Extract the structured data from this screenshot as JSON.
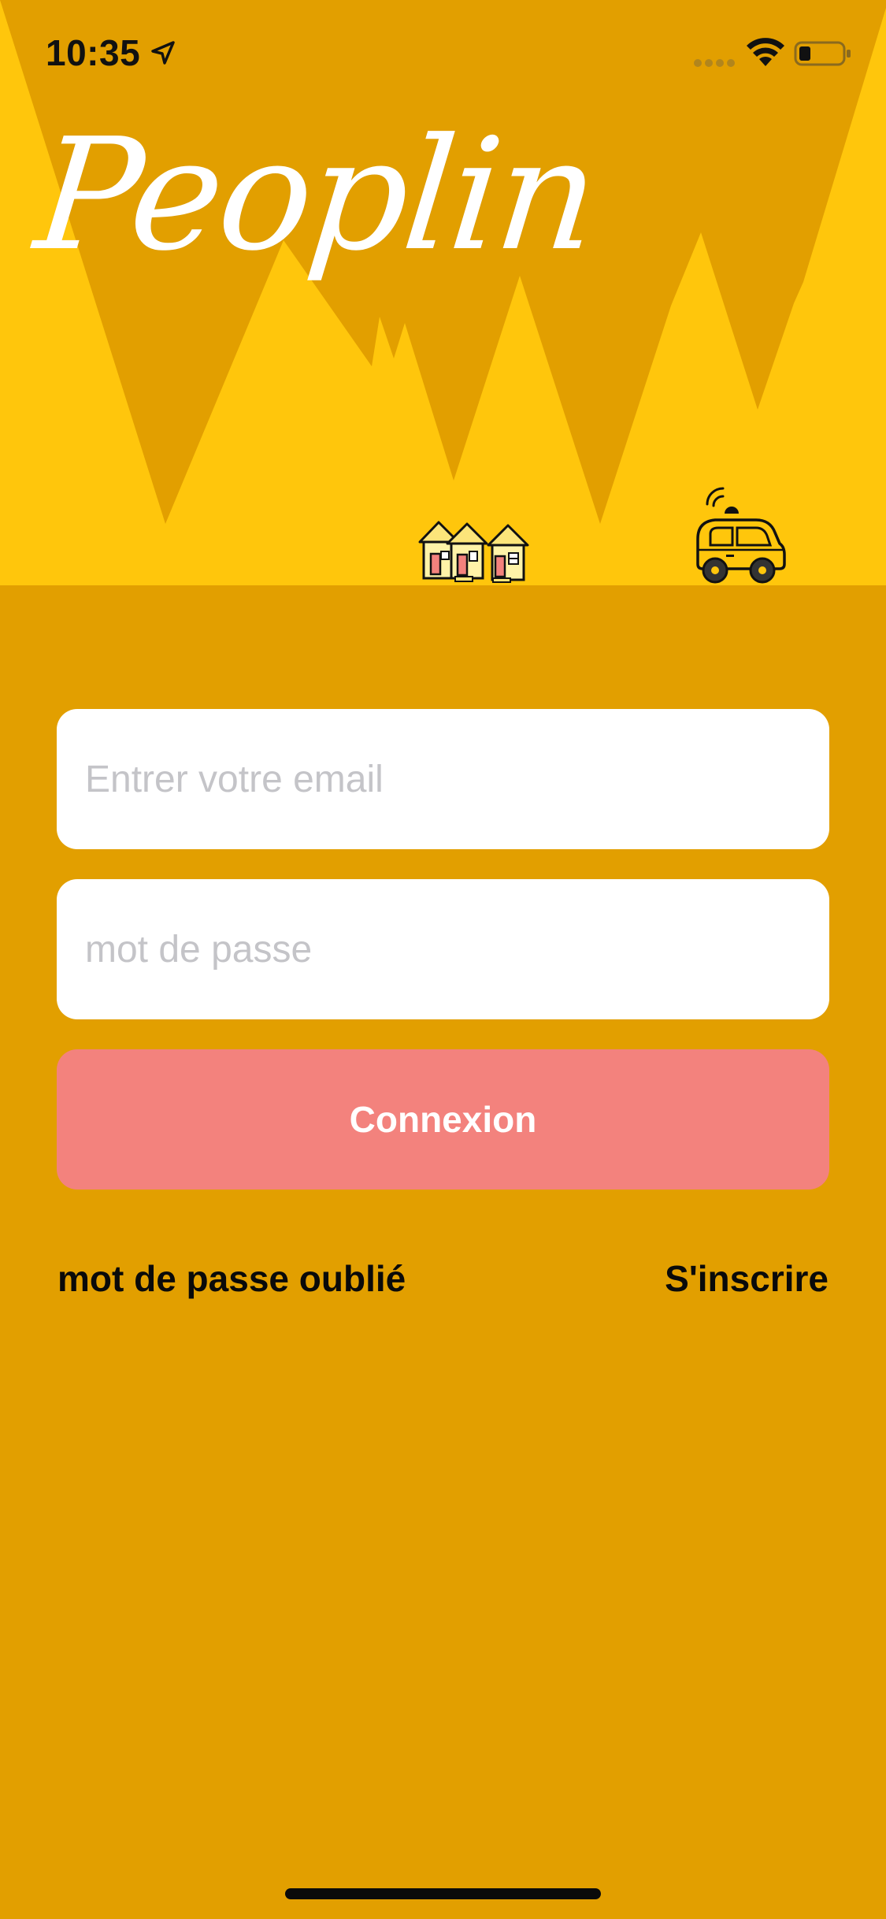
{
  "status_bar": {
    "time": "10:35",
    "location_icon": "location-arrow-icon",
    "signal_icon": "cellular-signal-icon",
    "wifi_icon": "wifi-icon",
    "battery_icon": "battery-low-icon"
  },
  "header": {
    "logo_text": "Peoplin",
    "illustration_icons": [
      "houses-icon",
      "connected-car-icon"
    ]
  },
  "form": {
    "email": {
      "value": "",
      "placeholder": "Entrer votre email"
    },
    "password": {
      "value": "",
      "placeholder": "mot de passe"
    },
    "submit_label": "Connexion"
  },
  "links": {
    "forgot_password": "mot de passe oublié",
    "signup": "S'inscrire"
  },
  "colors": {
    "background": "#E29F00",
    "sky": "#FFC60C",
    "button": "#F3827D",
    "field": "#FFFFFF",
    "text_dark": "#0A0A0A",
    "placeholder": "#C4C4C8"
  }
}
